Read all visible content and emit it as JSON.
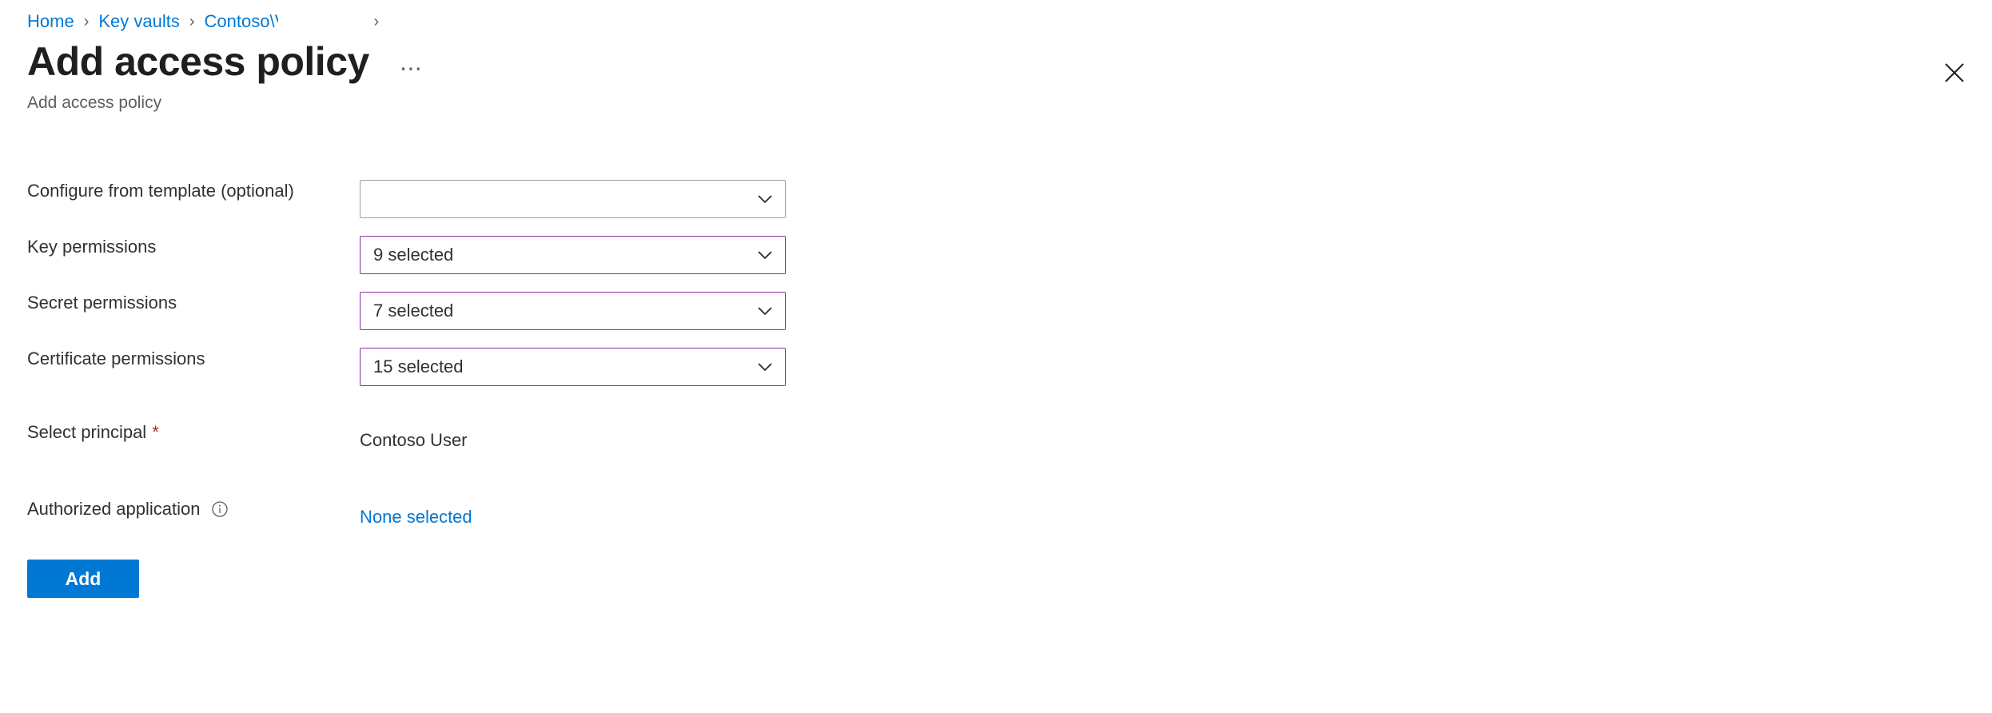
{
  "breadcrumb": {
    "items": [
      {
        "label": "Home"
      },
      {
        "label": "Key vaults"
      },
      {
        "label": "Contoso\\Vault"
      }
    ],
    "separator": "›",
    "trailing_separator": "›"
  },
  "header": {
    "title": "Add access policy",
    "subtitle": "Add access policy",
    "more_menu": "⋯",
    "close_label": "Close"
  },
  "form": {
    "rows": [
      {
        "label": "Configure from template (optional)",
        "control": "dropdown",
        "value": "",
        "accent": false
      },
      {
        "label": "Key permissions",
        "control": "dropdown",
        "value": "9 selected",
        "accent": true
      },
      {
        "label": "Secret permissions",
        "control": "dropdown",
        "value": "7 selected",
        "accent": true
      },
      {
        "label": "Certificate permissions",
        "control": "dropdown",
        "value": "15 selected",
        "accent": true
      },
      {
        "label": "Select principal",
        "required": "*",
        "control": "text",
        "value": "Contoso User"
      },
      {
        "label": "Authorized application",
        "info": "i",
        "control": "link",
        "value": "None selected"
      }
    ]
  },
  "actions": {
    "add_label": "Add"
  },
  "colors": {
    "link": "#0078d4",
    "accent_border": "#8b2fa8",
    "required": "#a4262c",
    "primary_button": "#0078d4",
    "text": "#323130",
    "muted": "#605e5c"
  }
}
